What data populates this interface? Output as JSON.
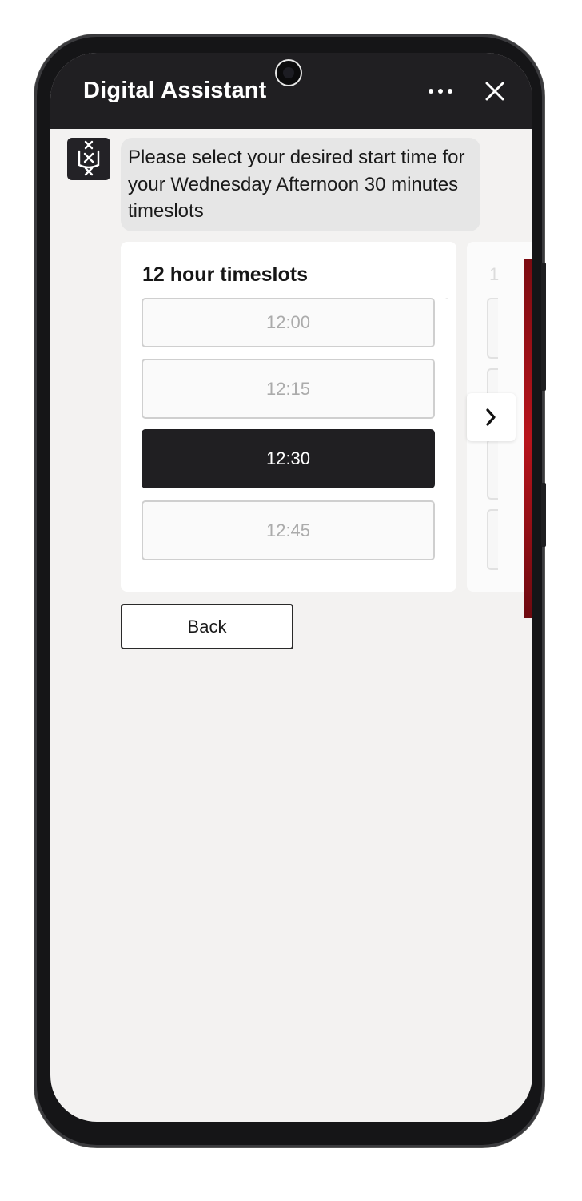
{
  "header": {
    "title": "Digital Assistant",
    "more_icon": "more-horizontal-icon",
    "close_icon": "close-icon"
  },
  "conversation": {
    "bot_avatar_icon": "university-logo-icon",
    "message": "Please select your desired start time for your Wednesday Afternoon 30 minutes timeslots"
  },
  "timeslot_card": {
    "title": "12 hour timeslots",
    "separator": "-",
    "slots": [
      {
        "label": "12:00",
        "selected": false
      },
      {
        "label": "12:15",
        "selected": false
      },
      {
        "label": "12:30",
        "selected": true
      },
      {
        "label": "12:45",
        "selected": false
      }
    ]
  },
  "next_card": {
    "title_partial": "1"
  },
  "carousel": {
    "next_icon": "chevron-right-icon"
  },
  "back_button": {
    "label": "Back"
  },
  "colors": {
    "header_bg": "#201f22",
    "selected_slot_bg": "#201f22",
    "screen_bg": "#f3f2f1",
    "bubble_bg": "#e6e6e6"
  }
}
